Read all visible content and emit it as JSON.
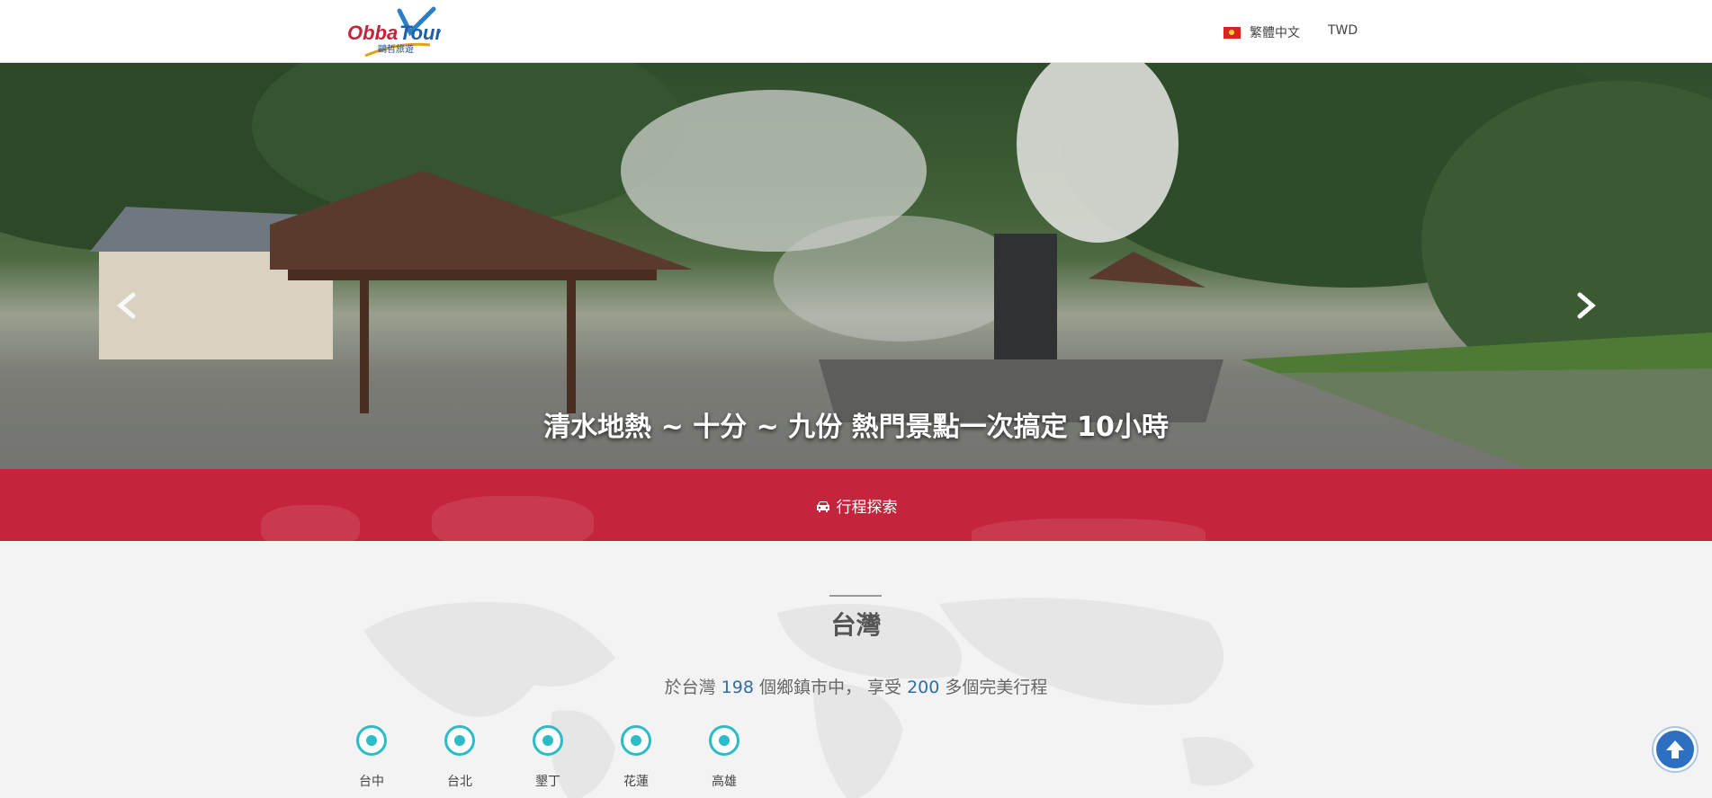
{
  "header": {
    "logo_text": "Obba Tour",
    "logo_subtext": "鷗哲旅遊",
    "language_label": "繁體中文",
    "currency_label": "TWD"
  },
  "hero": {
    "title": "清水地熱 ~ 十分 ~ 九份 熱門景點一次搞定 10小時",
    "prev_icon": "chevron-left-icon",
    "next_icon": "chevron-right-icon"
  },
  "band": {
    "explore_label": "行程探索",
    "explore_icon": "car-icon",
    "color": "#c4243c"
  },
  "region": {
    "title": "台灣",
    "stats": {
      "prefix": "於台灣 ",
      "towns": "198",
      "middle": " 個鄉鎮市中， 享受 ",
      "tours": "200",
      "suffix": " 多個完美行程"
    },
    "cities": [
      {
        "label": "台中"
      },
      {
        "label": "台北"
      },
      {
        "label": "墾丁"
      },
      {
        "label": "花蓮"
      },
      {
        "label": "高雄"
      }
    ]
  },
  "back_to_top_icon": "arrow-up-icon",
  "colors": {
    "accent_teal": "#2bbcc7",
    "link_blue": "#2d6fa6",
    "button_blue": "#2d6fc0"
  }
}
